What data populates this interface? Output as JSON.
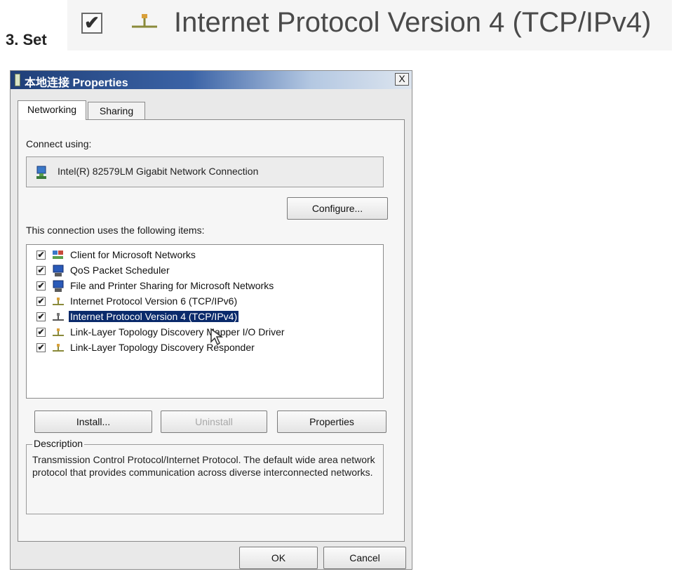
{
  "banner": {
    "step_label": "3.  Set",
    "checkbox_mark": "✔",
    "item_label": "Internet Protocol Version 4 (TCP/IPv4)"
  },
  "dialog": {
    "title": "本地连接 Properties",
    "close_label": "X",
    "tabs": [
      "Networking",
      "Sharing"
    ],
    "active_tab": "Networking",
    "connect_using_label": "Connect using:",
    "adapter_name": "Intel(R) 82579LM Gigabit Network Connection",
    "configure_label": "Configure...",
    "items_label": "This connection uses the following items:",
    "items": [
      {
        "label": "Client for Microsoft Networks",
        "checked": true,
        "icon": "network-client-icon"
      },
      {
        "label": "QoS Packet Scheduler",
        "checked": true,
        "icon": "computer-service-icon"
      },
      {
        "label": "File and Printer Sharing for Microsoft Networks",
        "checked": true,
        "icon": "computer-service-icon"
      },
      {
        "label": "Internet Protocol Version 6 (TCP/IPv6)",
        "checked": true,
        "icon": "protocol-icon"
      },
      {
        "label": "Internet Protocol Version 4 (TCP/IPv4)",
        "checked": true,
        "icon": "protocol-icon",
        "selected": true
      },
      {
        "label": "Link-Layer Topology Discovery Mapper I/O Driver",
        "checked": true,
        "icon": "protocol-icon"
      },
      {
        "label": "Link-Layer Topology Discovery Responder",
        "checked": true,
        "icon": "protocol-icon"
      }
    ],
    "check_mark": "✔",
    "install_label": "Install...",
    "uninstall_label": "Uninstall",
    "properties_label": "Properties",
    "description_title": "Description",
    "description_text": "Transmission Control Protocol/Internet Protocol. The default wide area network protocol that provides communication across diverse interconnected networks.",
    "ok_label": "OK",
    "cancel_label": "Cancel"
  },
  "colors": {
    "selection": "#0a2a6b",
    "title_bar": "#1f3f78",
    "dialog_bg": "#e9e9e9"
  }
}
